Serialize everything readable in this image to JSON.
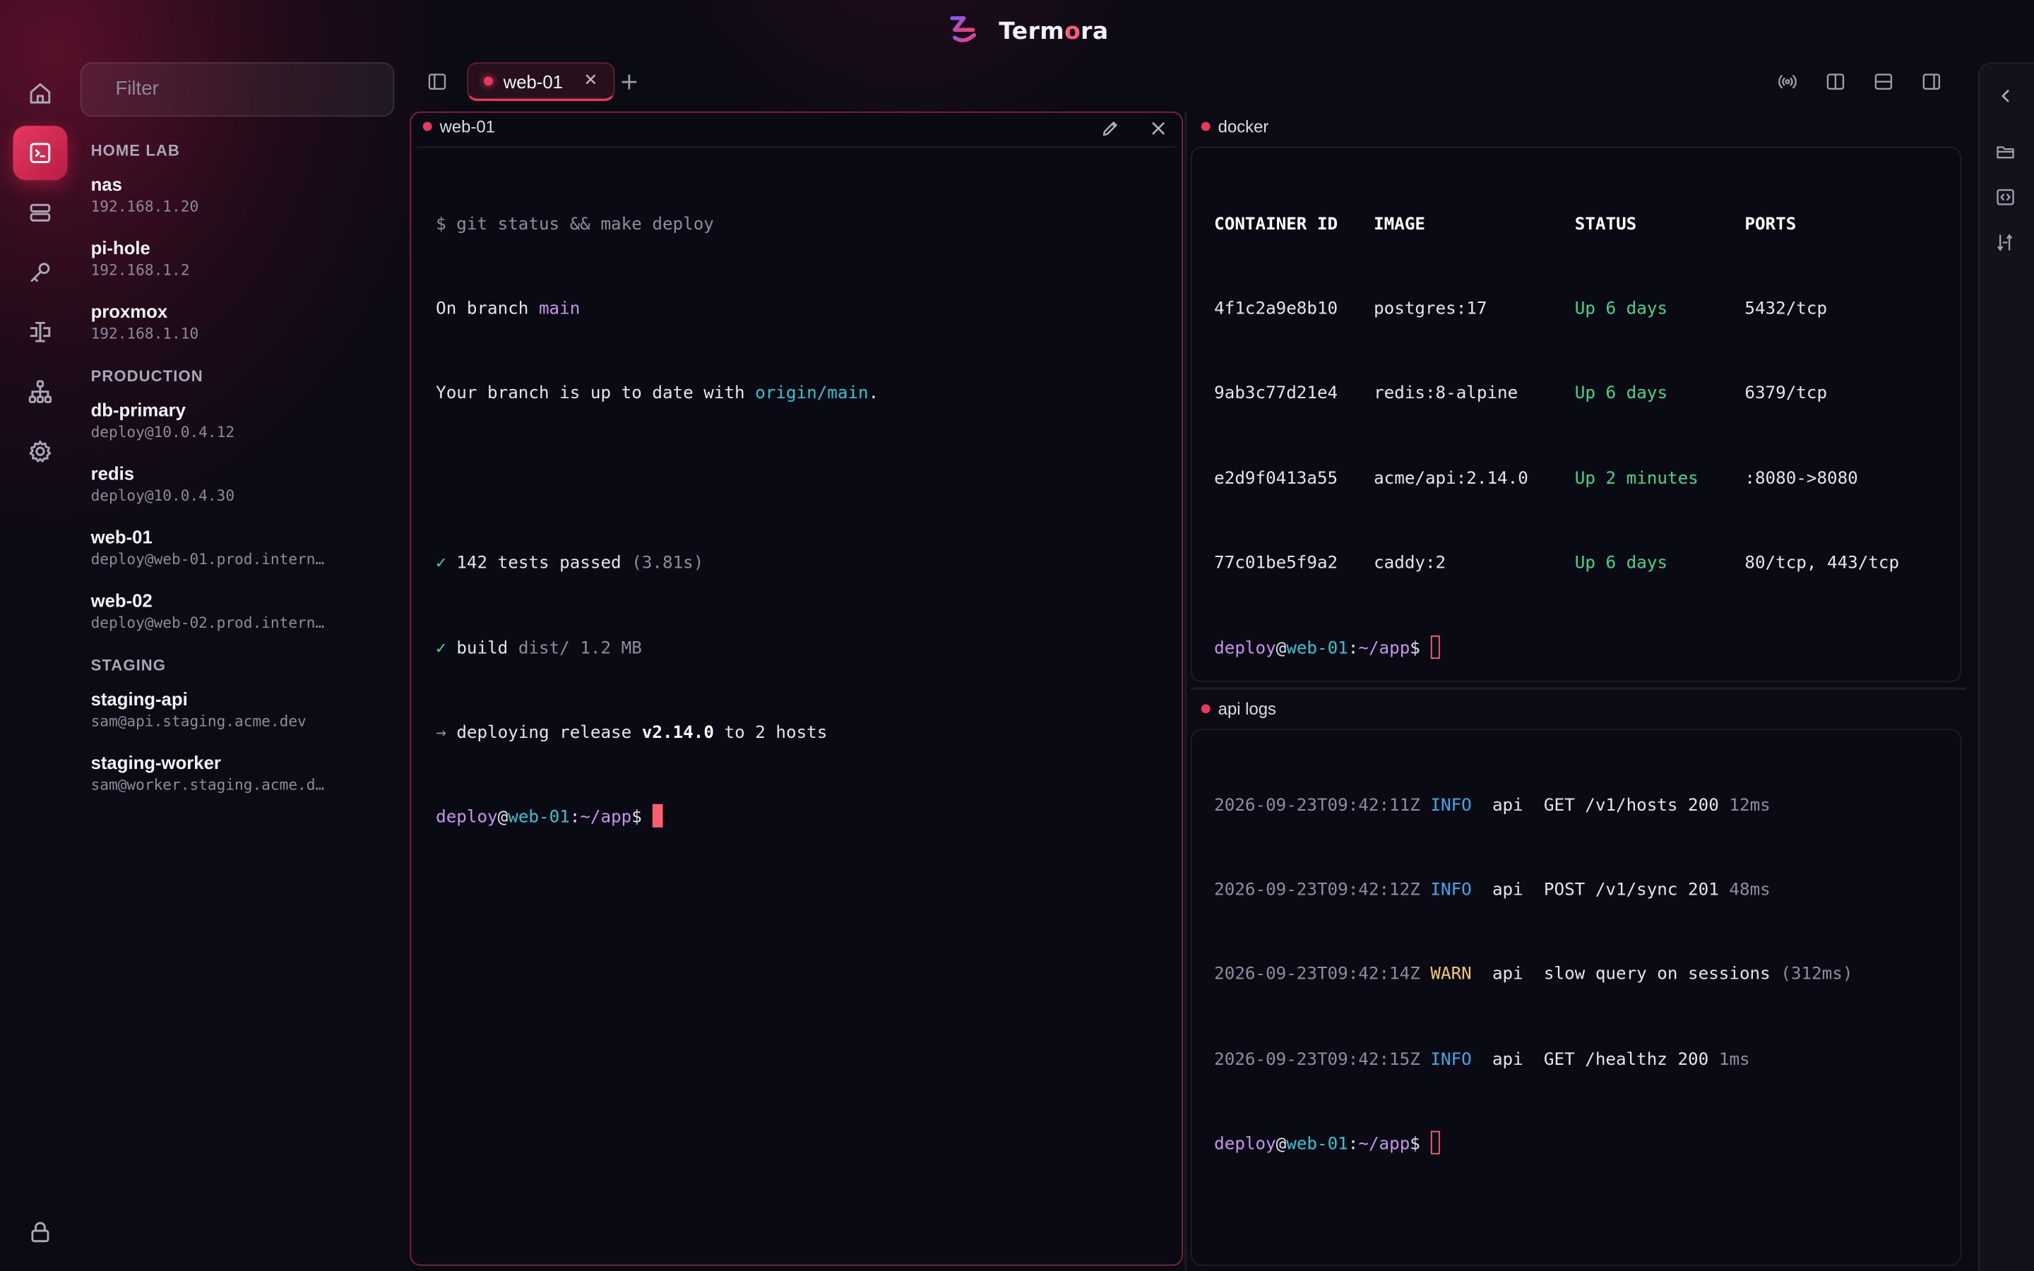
{
  "app": {
    "name_prefix": "Term",
    "name_accent": "o",
    "name_suffix": "ra"
  },
  "colors": {
    "accent": "#e8385e",
    "prompt_user": "#c792ea",
    "prompt_host": "#2fc4cf",
    "ok": "#3fd68a",
    "warn": "#f5c76a",
    "info": "#3aa9e8"
  },
  "rail": {
    "top": [
      "home-icon",
      "terminal-icon",
      "servers-icon",
      "key-icon",
      "port-forward-icon",
      "network-icon",
      "gear-icon"
    ],
    "bottom": "lock-icon",
    "active": "terminal-icon"
  },
  "sidebar": {
    "filter_placeholder": "Filter",
    "groups": [
      {
        "title": "HOME LAB",
        "hosts": [
          {
            "name": "nas",
            "address": "192.168.1.20"
          },
          {
            "name": "pi-hole",
            "address": "192.168.1.2"
          },
          {
            "name": "proxmox",
            "address": "192.168.1.10"
          }
        ]
      },
      {
        "title": "PRODUCTION",
        "hosts": [
          {
            "name": "db-primary",
            "address": "deploy@10.0.4.12"
          },
          {
            "name": "redis",
            "address": "deploy@10.0.4.30"
          },
          {
            "name": "web-01",
            "address": "deploy@web-01.prod.intern…"
          },
          {
            "name": "web-02",
            "address": "deploy@web-02.prod.intern…"
          }
        ]
      },
      {
        "title": "STAGING",
        "hosts": [
          {
            "name": "staging-api",
            "address": "sam@api.staging.acme.dev"
          },
          {
            "name": "staging-worker",
            "address": "sam@worker.staging.acme.d…"
          }
        ]
      }
    ]
  },
  "tabs": [
    {
      "label": "web-01",
      "close": "✕"
    }
  ],
  "new_tab": "+",
  "toolbar_icons": [
    "broadcast-icon",
    "split-vertical-icon",
    "split-horizontal-icon",
    "right-panel-icon"
  ],
  "panes": {
    "web01": {
      "title": "web-01",
      "lines": {
        "cmd": "$ git status && make deploy",
        "branch_pre": "On branch ",
        "branch": "main",
        "uptodate_pre": "Your branch is up to date with ",
        "uptodate_ref": "origin/main",
        "uptodate_post": ".",
        "tests_check": "✓",
        "tests_text": " 142 tests passed ",
        "tests_time": "(3.81s)",
        "build_check": "✓",
        "build_text": " build ",
        "build_path": "dist/ 1.2 MB",
        "deploy_arrow": "→",
        "deploy_text": " deploying release ",
        "deploy_version": "v2.14.0",
        "deploy_post": " to 2 hosts"
      },
      "prompt": {
        "user": "deploy",
        "at": "@",
        "host": "web-01",
        "colon": ":",
        "path": "~/app",
        "dollar": "$ "
      }
    },
    "docker": {
      "title": "docker",
      "headers": [
        "CONTAINER ID",
        "IMAGE",
        "STATUS",
        "PORTS"
      ],
      "rows": [
        {
          "id": "4f1c2a9e8b10",
          "image": "postgres:17",
          "status": "Up 6 days",
          "ports": "5432/tcp"
        },
        {
          "id": "9ab3c77d21e4",
          "image": "redis:8-alpine",
          "status": "Up 6 days",
          "ports": "6379/tcp"
        },
        {
          "id": "e2d9f0413a55",
          "image": "acme/api:2.14.0",
          "status": "Up 2 minutes",
          "ports": ":8080->8080"
        },
        {
          "id": "77c01be5f9a2",
          "image": "caddy:2",
          "status": "Up 6 days",
          "ports": "80/tcp, 443/tcp"
        }
      ],
      "prompt": {
        "user": "deploy",
        "at": "@",
        "host": "web-01",
        "colon": ":",
        "path": "~/app",
        "dollar": "$ "
      }
    },
    "logs": {
      "title": "api logs",
      "rows": [
        {
          "ts": "2026-09-23T09:42:11Z",
          "level": "INFO",
          "svc": "api",
          "msg": "GET /v1/hosts 200",
          "extra": "12ms"
        },
        {
          "ts": "2026-09-23T09:42:12Z",
          "level": "INFO",
          "svc": "api",
          "msg": "POST /v1/sync 201",
          "extra": "48ms"
        },
        {
          "ts": "2026-09-23T09:42:14Z",
          "level": "WARN",
          "svc": "api",
          "msg": "slow query on sessions",
          "extra": "(312ms)"
        },
        {
          "ts": "2026-09-23T09:42:15Z",
          "level": "INFO",
          "svc": "api",
          "msg": "GET /healthz 200",
          "extra": "1ms"
        }
      ],
      "prompt": {
        "user": "deploy",
        "at": "@",
        "host": "web-01",
        "colon": ":",
        "path": "~/app",
        "dollar": "$ "
      }
    }
  },
  "right_rail": [
    "collapse-left-icon",
    "folder-icon",
    "snippets-icon",
    "port-tunnel-icon"
  ]
}
